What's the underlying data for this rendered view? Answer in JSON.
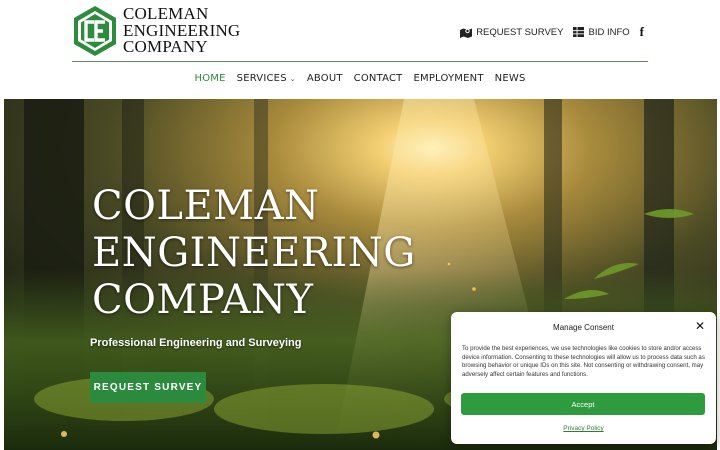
{
  "header": {
    "logo": {
      "lines": [
        "COLEMAN",
        "ENGINEERING",
        "COMPANY"
      ],
      "mark_letters": "CE",
      "mark_color": "#2e8b3d"
    },
    "top_links": {
      "request_survey": "REQUEST SURVEY",
      "bid_info": "BID INFO",
      "facebook": "f"
    }
  },
  "nav": {
    "items": [
      {
        "label": "HOME",
        "active": true
      },
      {
        "label": "SERVICES",
        "has_dropdown": true
      },
      {
        "label": "ABOUT"
      },
      {
        "label": "CONTACT"
      },
      {
        "label": "EMPLOYMENT"
      },
      {
        "label": "NEWS"
      }
    ],
    "caret": "⌄"
  },
  "hero": {
    "title_lines": [
      "COLEMAN",
      "ENGINEERING",
      "COMPANY"
    ],
    "subtitle": "Professional Engineering and Surveying",
    "button_label": "REQUEST SURVEY",
    "button_color": "#2b8a3e"
  },
  "consent": {
    "title": "Manage Consent",
    "close": "✕",
    "text": "To provide the best experiences, we use technologies like cookies to store and/or access device information. Consenting to these technologies will allow us to process data such as browsing behavior or unique IDs on this site. Not consenting or withdrawing consent, may adversely affect certain features and functions.",
    "accept_label": "Accept",
    "policy_link": "Privacy Policy",
    "accent": "#2e9b3f"
  }
}
